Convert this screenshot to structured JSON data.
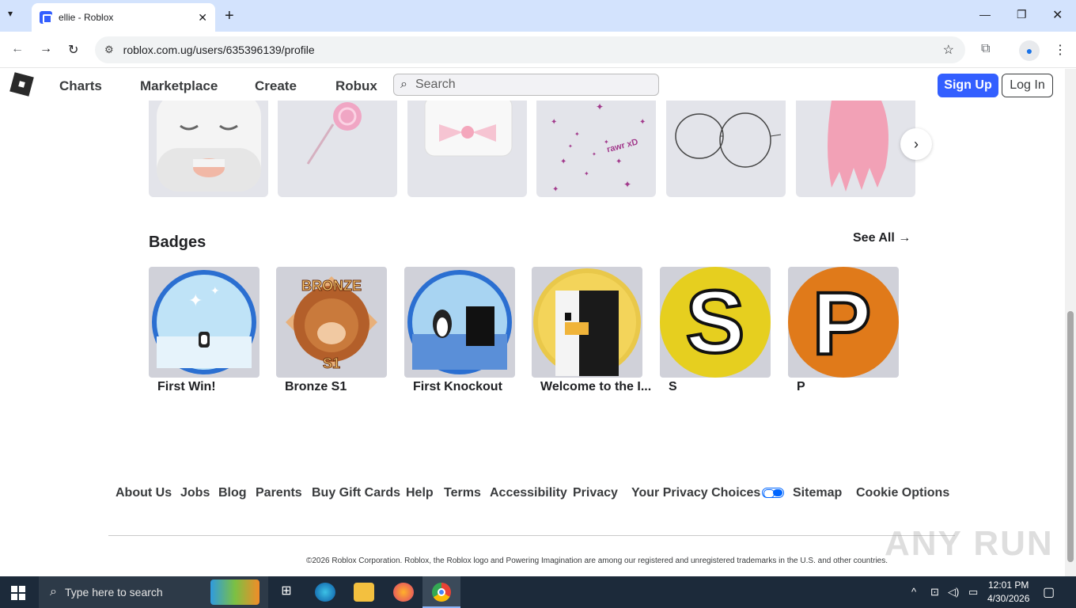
{
  "browser": {
    "tab_title": "ellie - Roblox",
    "url": "roblox.com.ug/users/635396139/profile"
  },
  "header": {
    "nav": [
      "Charts",
      "Marketplace",
      "Create",
      "Robux"
    ],
    "search_placeholder": "Search",
    "signup_label": "Sign Up",
    "login_label": "Log In"
  },
  "items": {
    "overlay_text": "rawr xD"
  },
  "badges": {
    "title": "Badges",
    "see_all": "See All",
    "list": [
      {
        "label": "First Win!"
      },
      {
        "label": "Bronze S1"
      },
      {
        "label": "First Knockout"
      },
      {
        "label": "Welcome to the I..."
      },
      {
        "label": "S"
      },
      {
        "label": "P"
      }
    ],
    "bronze_text": "BRONZE",
    "s1_text": "S1",
    "s_letter": "S",
    "p_letter": "P"
  },
  "footer": {
    "links": [
      "About Us",
      "Jobs",
      "Blog",
      "Parents",
      "Buy Gift Cards",
      "Help",
      "Terms",
      "Accessibility",
      "Privacy",
      "Your Privacy Choices",
      "Sitemap",
      "Cookie Options"
    ],
    "copyright": "©2026 Roblox Corporation. Roblox, the Roblox logo and Powering Imagination are among our registered and unregistered trademarks in the U.S. and other countries."
  },
  "watermark": "ANY RUN",
  "taskbar": {
    "search_placeholder": "Type here to search",
    "time": "12:01 PM",
    "date": "4/30/2026"
  },
  "colors": {
    "brand_blue": "#335fff",
    "bronze": "#c97a3c",
    "s_yellow": "#e6cf1f",
    "p_orange": "#e07a1a"
  }
}
